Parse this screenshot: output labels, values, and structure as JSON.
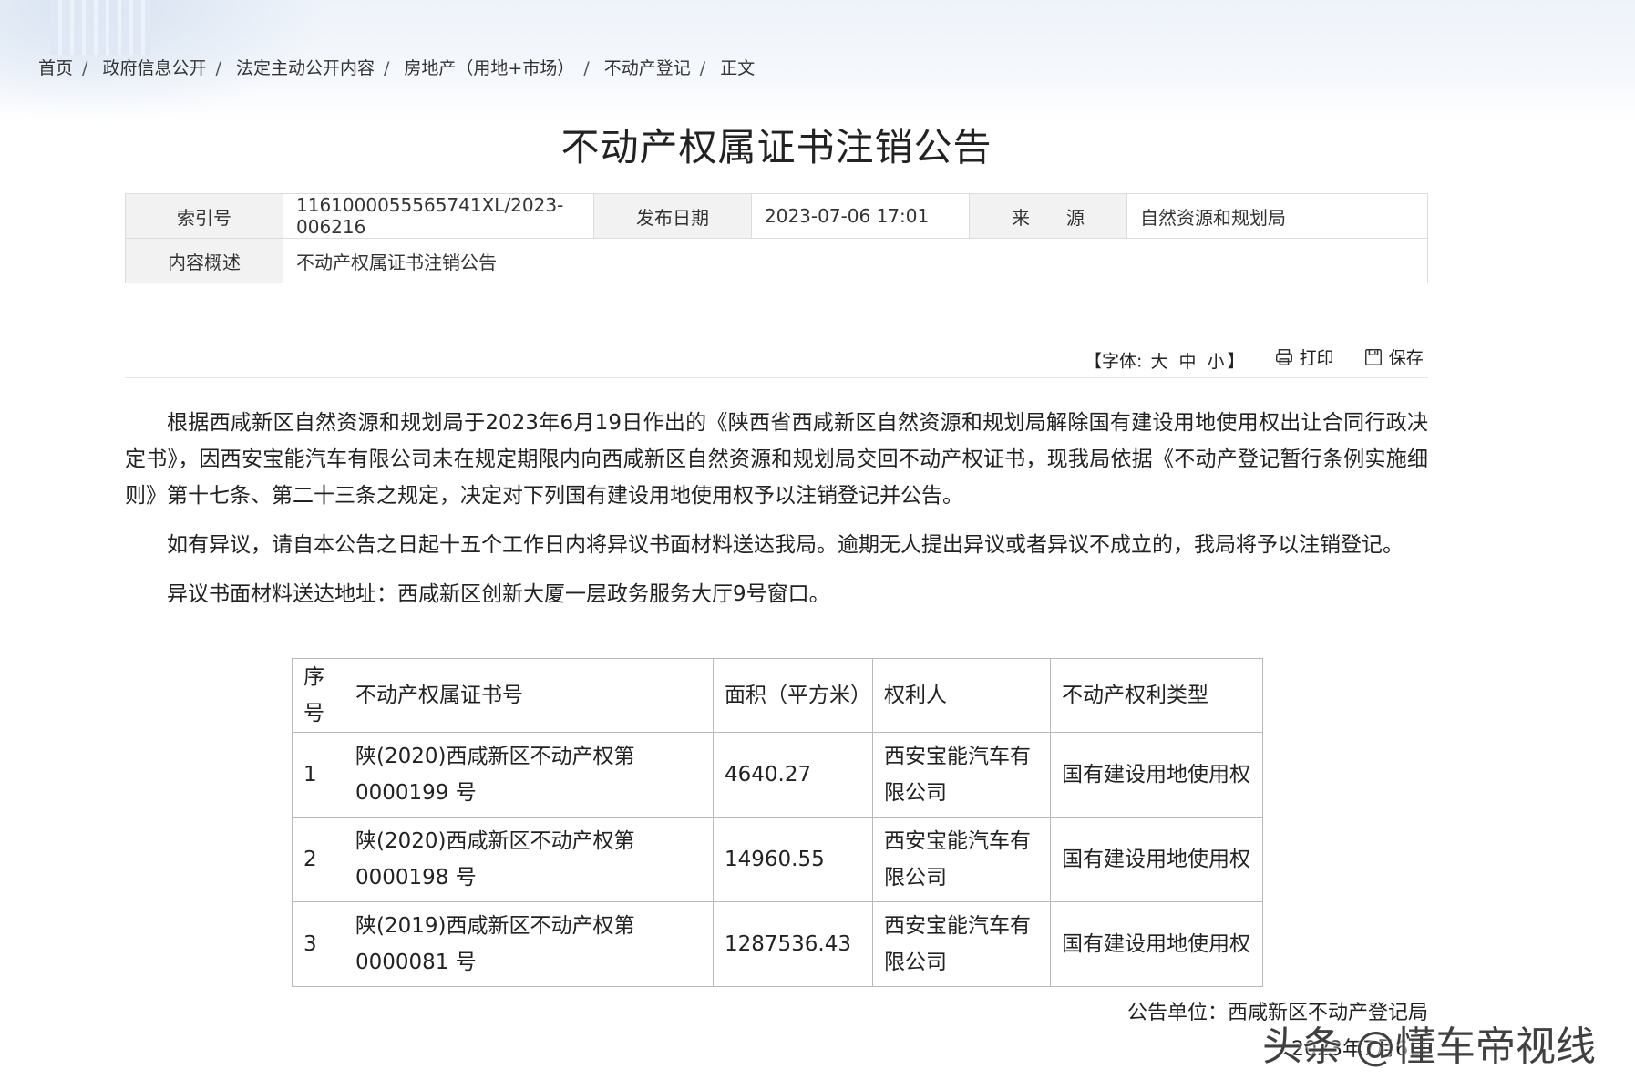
{
  "breadcrumb": [
    "首页",
    "政府信息公开",
    "法定主动公开内容",
    "房地产（用地+市场）",
    "不动产登记",
    "正文"
  ],
  "title": "不动产权属证书注销公告",
  "meta": {
    "index_label": "索引号",
    "index_value": "1161000055565741XL/2023-006216",
    "date_label": "发布日期",
    "date_value": "2023-07-06 17:01",
    "source_label": "来　　源",
    "source_value": "自然资源和规划局",
    "summary_label": "内容概述",
    "summary_value": "不动产权属证书注销公告"
  },
  "tools": {
    "font_label": "【字体:",
    "size_large": "大",
    "size_medium": "中",
    "size_small": "小",
    "font_close": "】",
    "print": "打印",
    "save": "保存"
  },
  "body": {
    "p1": "根据西咸新区自然资源和规划局于2023年6月19日作出的《陕西省西咸新区自然资源和规划局解除国有建设用地使用权出让合同行政决定书》，因西安宝能汽车有限公司未在规定期限内向西咸新区自然资源和规划局交回不动产权证书，现我局依据《不动产登记暂行条例实施细则》第十七条、第二十三条之规定，决定对下列国有建设用地使用权予以注销登记并公告。",
    "p2": "如有异议，请自本公告之日起十五个工作日内将异议书面材料送达我局。逾期无人提出异议或者异议不成立的，我局将予以注销登记。",
    "p3": "异议书面材料送达地址：西咸新区创新大厦一层政务服务大厅9号窗口。"
  },
  "table": {
    "headers": [
      "序号",
      "不动产权属证书号",
      "面积（平方米）",
      "权利人",
      "不动产权利类型"
    ],
    "rows": [
      [
        "1",
        "陕(2020)西咸新区不动产权第0000199 号",
        "4640.27",
        "西安宝能汽车有限公司",
        "国有建设用地使用权"
      ],
      [
        "2",
        "陕(2020)西咸新区不动产权第0000198 号",
        "14960.55",
        "西安宝能汽车有限公司",
        "国有建设用地使用权"
      ],
      [
        "3",
        "陕(2019)西咸新区不动产权第0000081 号",
        "1287536.43",
        "西安宝能汽车有限公司",
        "国有建设用地使用权"
      ]
    ]
  },
  "sign": {
    "unit": "公告单位：西咸新区不动产登记局",
    "date": "2023年7月6日"
  },
  "watermark": "头条 @懂车帝视线"
}
